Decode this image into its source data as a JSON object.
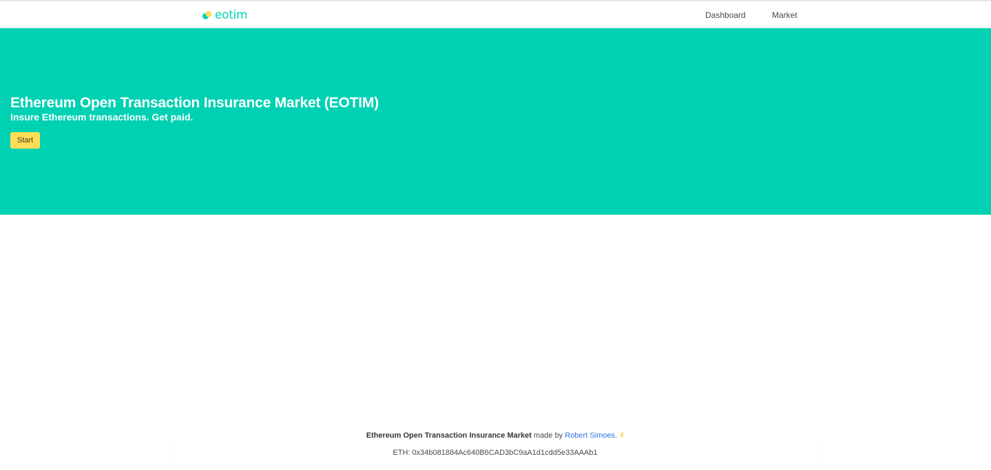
{
  "navbar": {
    "brand_text": "eotim",
    "items": [
      {
        "label": "Dashboard"
      },
      {
        "label": "Market"
      }
    ]
  },
  "hero": {
    "title": "Ethereum Open Transaction Insurance Market (EOTIM)",
    "subtitle": "Insure Ethereum transactions. Get paid.",
    "start_label": "Start"
  },
  "footer": {
    "project_name": "Ethereum Open Transaction Insurance Market",
    "made_by_text": " made by ",
    "author": "Robert Simoes",
    "after_author": ".",
    "emoji_icon": "victory-hand-icon",
    "eth_address_line": "ETH: 0x34b081884Ac640B6CAD3bC9aA1d1cdd5e33AAAb1"
  },
  "colors": {
    "primary": "#00d1b2",
    "warning": "#ffdd57",
    "link": "#3273dc",
    "text": "#4a4a4a"
  }
}
